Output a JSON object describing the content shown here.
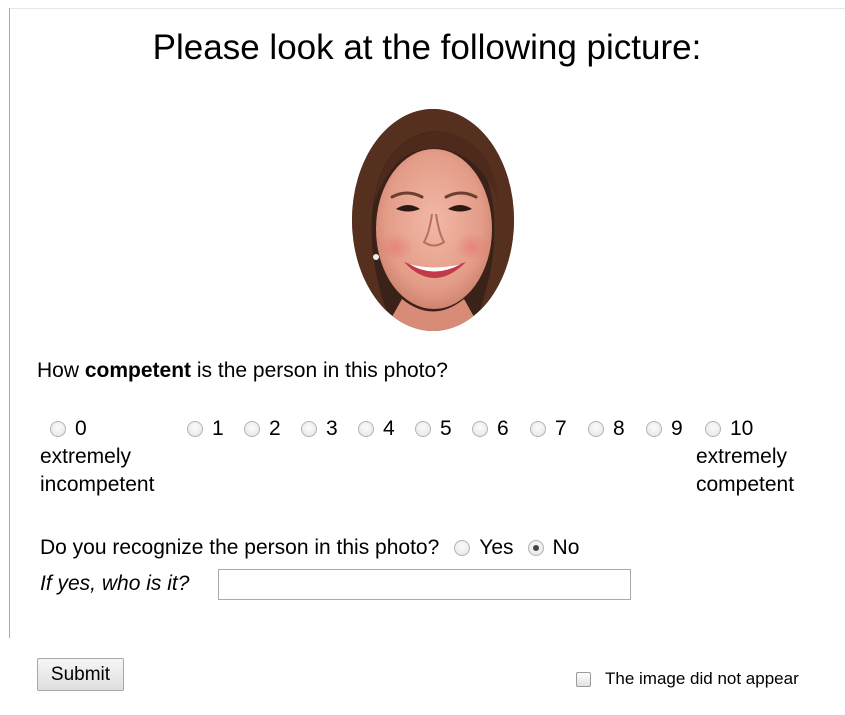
{
  "page": {
    "title": "Please look at the following picture:"
  },
  "photo": {
    "subject": "smiling woman portrait (oval)"
  },
  "rating": {
    "question_prefix": "How ",
    "question_emphasis": "competent",
    "question_suffix": " is the person in this photo?",
    "scale": [
      "0",
      "1",
      "2",
      "3",
      "4",
      "5",
      "6",
      "7",
      "8",
      "9",
      "10"
    ],
    "selected": null,
    "low_anchor_line1": "extremely",
    "low_anchor_line2": "incompetent",
    "high_anchor_line1": "extremely",
    "high_anchor_line2": "competent"
  },
  "recognize": {
    "question": "Do you recognize the person in this photo?",
    "options": [
      "Yes",
      "No"
    ],
    "selected": "No"
  },
  "identify": {
    "label": "If yes, who is it?",
    "value": "",
    "placeholder": ""
  },
  "actions": {
    "submit_label": "Submit",
    "image_missing_label": "The image did not appear",
    "image_missing_checked": false
  },
  "colors": {
    "skin": "#e8a493",
    "hair": "#4a2a1f",
    "lips": "#c2394a",
    "border": "#a9a9a9"
  }
}
